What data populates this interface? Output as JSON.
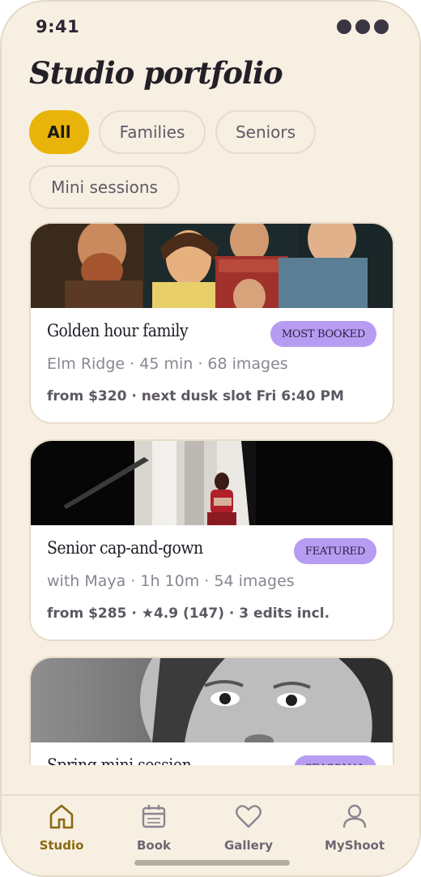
{
  "status": {
    "time": "9:41"
  },
  "page": {
    "title": "Studio portfolio"
  },
  "filters": [
    {
      "label": "All",
      "active": true
    },
    {
      "label": "Families",
      "active": false
    },
    {
      "label": "Seniors",
      "active": false
    },
    {
      "label": "Mini sessions",
      "active": false
    }
  ],
  "cards": [
    {
      "title": "Golden hour family",
      "badge": "MOST BOOKED",
      "meta": "Elm Ridge · 45 min · 68 images",
      "price": "from $320 · next dusk slot Fri 6:40 PM"
    },
    {
      "title": "Senior cap-and-gown",
      "badge": "FEATURED",
      "meta": "with Maya · 1h 10m · 54 images",
      "price": "from $285 · ★4.9 (147) · 3 edits incl."
    },
    {
      "title": "Spring mini session",
      "badge": "SEASONAL"
    }
  ],
  "tabs": [
    {
      "label": "Studio",
      "icon": "home-icon",
      "active": true
    },
    {
      "label": "Book",
      "icon": "calendar-icon",
      "active": false
    },
    {
      "label": "Gallery",
      "icon": "heart-icon",
      "active": false
    },
    {
      "label": "MyShoot",
      "icon": "person-icon",
      "active": false
    }
  ],
  "colors": {
    "background": "#f7efe2",
    "accent": "#e8b40a",
    "badge": "#b79cf2",
    "active_tab": "#8a6a0e"
  }
}
